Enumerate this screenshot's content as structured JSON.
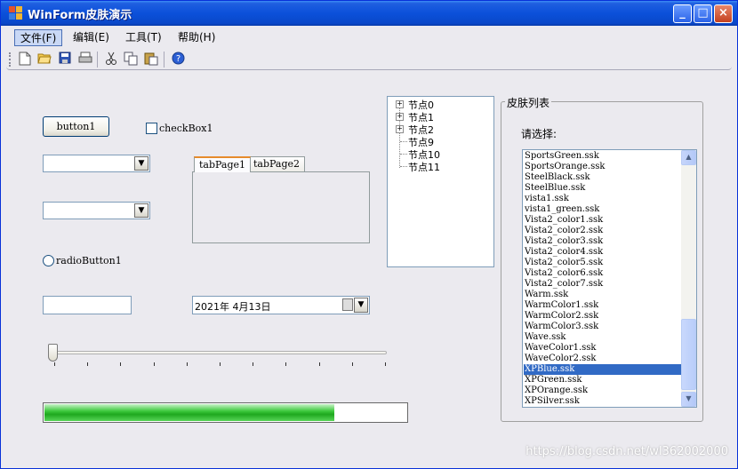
{
  "window": {
    "title": "WinForm皮肤演示"
  },
  "titlebar_buttons": {
    "minimize": "_",
    "maximize": "□",
    "close": "×"
  },
  "menu": {
    "items": [
      {
        "label": "文件(F)"
      },
      {
        "label": "编辑(E)"
      },
      {
        "label": "工具(T)"
      },
      {
        "label": "帮助(H)"
      }
    ]
  },
  "toolbar": {
    "icons": [
      "new-file-icon",
      "open-folder-icon",
      "save-icon",
      "print-icon",
      "cut-icon",
      "copy-icon",
      "paste-icon",
      "help-icon"
    ]
  },
  "controls": {
    "button1": "button1",
    "checkbox1": "checkBox1",
    "radiobutton1": "radioButton1",
    "combo1_value": "",
    "combo2_value": "",
    "textbox_value": "",
    "tabs": [
      {
        "label": "tabPage1"
      },
      {
        "label": "tabPage2"
      }
    ],
    "date": "2021年  4月13日",
    "trackbar_value": 0,
    "trackbar_max": 10,
    "progress_fraction": 0.8
  },
  "tree": {
    "nodes": [
      {
        "label": "节点0",
        "expandable": true
      },
      {
        "label": "节点1",
        "expandable": true
      },
      {
        "label": "节点2",
        "expandable": true
      },
      {
        "label": "节点9",
        "expandable": false
      },
      {
        "label": "节点10",
        "expandable": false
      },
      {
        "label": "节点11",
        "expandable": false
      }
    ]
  },
  "skins": {
    "group_title": "皮肤列表",
    "prompt": "请选择:",
    "selected": "XPBlue.ssk",
    "items": [
      "SportsGreen.ssk",
      "SportsOrange.ssk",
      "SteelBlack.ssk",
      "SteelBlue.ssk",
      "vista1.ssk",
      "vista1_green.ssk",
      "Vista2_color1.ssk",
      "Vista2_color2.ssk",
      "Vista2_color3.ssk",
      "Vista2_color4.ssk",
      "Vista2_color5.ssk",
      "Vista2_color6.ssk",
      "Vista2_color7.ssk",
      "Warm.ssk",
      "WarmColor1.ssk",
      "WarmColor2.ssk",
      "WarmColor3.ssk",
      "Wave.ssk",
      "WaveColor1.ssk",
      "WaveColor2.ssk",
      "XPBlue.ssk",
      "XPGreen.ssk",
      "XPOrange.ssk",
      "XPSilver.ssk"
    ]
  },
  "watermark": "https://blog.csdn.net/wl362002000",
  "colors": {
    "selection": "#316ac5",
    "progress_green": "#1ea81e",
    "titlebar_blue": "#0b50da"
  }
}
